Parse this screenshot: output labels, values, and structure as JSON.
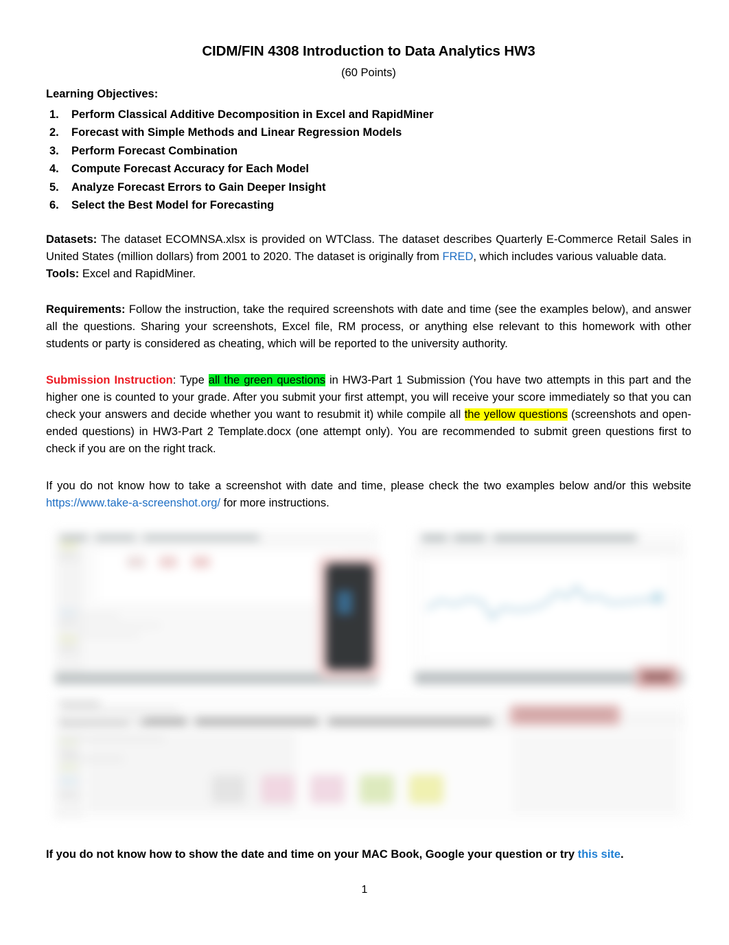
{
  "document": {
    "title": "CIDM/FIN 4308 Introduction to Data Analytics HW3",
    "points": "(60 Points)",
    "page_number": "1"
  },
  "learning_objectives": {
    "heading": "Learning Objectives:",
    "items": [
      {
        "num": "1.",
        "label": "Perform Classical Additive Decomposition in Excel and RapidMiner"
      },
      {
        "num": "2.",
        "label": "Forecast with Simple Methods and Linear Regression Models"
      },
      {
        "num": "3.",
        "label": "Perform Forecast Combination"
      },
      {
        "num": "4.",
        "label": "Compute Forecast Accuracy for Each Model"
      },
      {
        "num": "5.",
        "label": "Analyze Forecast Errors to Gain Deeper Insight"
      },
      {
        "num": "6.",
        "label": "Select the Best Model for Forecasting"
      }
    ]
  },
  "datasets": {
    "label": "Datasets:",
    "text_1": " The dataset ECOMNSA.xlsx is provided on WTClass. The dataset describes Quarterly E-Commerce Retail Sales in United States (million dollars) from 2001 to 2020. The dataset is originally from ",
    "link": "FRED",
    "text_2": ", which includes various valuable data."
  },
  "tools": {
    "label": "Tools:",
    "text": " Excel and RapidMiner."
  },
  "requirements": {
    "label": "Requirements:",
    "text": " Follow the instruction, take the required screenshots with date and time (see the examples below), and answer all the questions. Sharing your screenshots, Excel file, RM process, or anything else relevant to this homework with other students or party is considered as cheating, which will be reported to the university authority."
  },
  "submission": {
    "label": "Submission Instruction",
    "text_1": ": Type ",
    "green_highlight": "all the green questions",
    "text_2": " in HW3-Part 1 Submission (You have two attempts in this part and the higher one is counted to your grade. After you submit your first attempt, you will receive your score immediately so that you can check your answers and decide whether you want to resubmit it) while compile all ",
    "yellow_highlight": "the yellow questions",
    "text_3": " (screenshots and open-ended questions) in HW3-Part 2 Template.docx (one attempt only). You are recommended to submit green questions first to check if you are on the right track."
  },
  "screenshot_help": {
    "text_1": "If you do not know how to take a screenshot with date and time, please check the two examples below and/or this website ",
    "link": "https://www.take-a-screenshot.org/",
    "text_2": " for more instructions."
  },
  "examples": {
    "caption_hidden": "Two blurred example screenshots showing date and time"
  },
  "mac_help": {
    "text_1": "If you do not know how to show the date and time on your MAC Book, Google your question or try ",
    "link": "this site",
    "text_2": "."
  },
  "colors": {
    "link_blue": "#1f6fc4",
    "red": "#ec1c24",
    "green_highlight": "#00f022",
    "yellow_highlight": "#ffff00"
  }
}
